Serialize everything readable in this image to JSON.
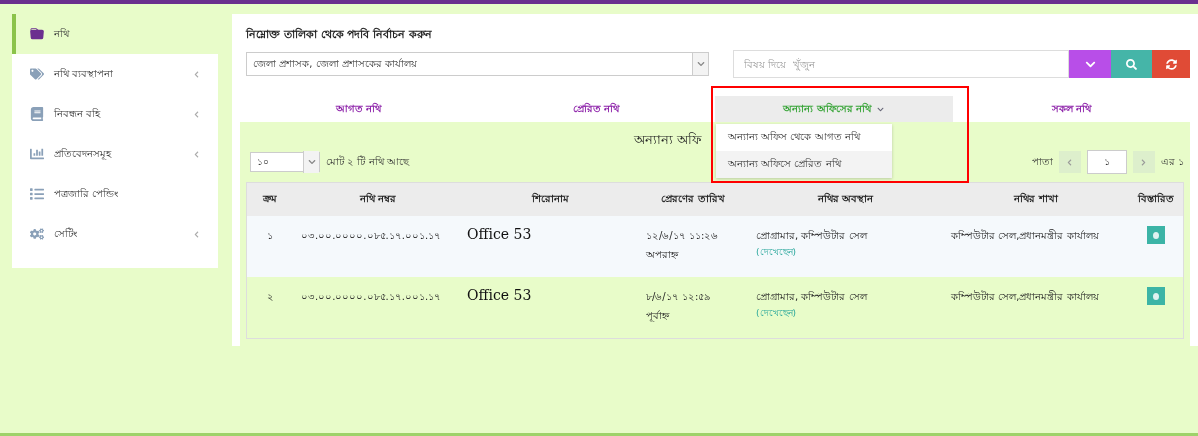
{
  "sidebar": {
    "items": [
      {
        "label": "নথি",
        "selected": true,
        "has_submenu": false
      },
      {
        "label": "নথি ব্যবস্থাপনা",
        "selected": false,
        "has_submenu": true
      },
      {
        "label": "নিবন্ধন বহি",
        "selected": false,
        "has_submenu": true
      },
      {
        "label": "প্রতিবেদনসমূহ",
        "selected": false,
        "has_submenu": true
      },
      {
        "label": "পত্রজারি পেন্ডিং",
        "selected": false,
        "has_submenu": false
      },
      {
        "label": "সেটিং",
        "selected": false,
        "has_submenu": true
      }
    ]
  },
  "position_picker": {
    "label": "নিম্নোক্ত তালিকা থেকে পদবি নির্বাচন করুন",
    "value": "জেলা প্রশাসক, জেলা প্রশাসকের কার্যালয়"
  },
  "search": {
    "placeholder": "বিষয় দিয়ে  খুঁজুন"
  },
  "tabs": [
    {
      "label": "আগত নথি",
      "selected": false,
      "has_menu": false
    },
    {
      "label": "প্রেরিত নথি",
      "selected": false,
      "has_menu": false
    },
    {
      "label": "অন্যান্য অফিসের নথি",
      "selected": true,
      "has_menu": true
    },
    {
      "label": "সকল নথি",
      "selected": false,
      "has_menu": false
    }
  ],
  "tab_menu": {
    "items": [
      {
        "label": "অন্যান্য অফিস থেকে আগত নথি",
        "selected": false
      },
      {
        "label": "অন্যান্য অফিসে প্রেরিত নথি",
        "selected": true
      }
    ]
  },
  "list": {
    "heading": "অন্যান্য অফি",
    "page_size": "১০",
    "total": "মোট ২ টি নথি আছে",
    "page_label": "পাতা",
    "page": "১",
    "page_of": "এর ১",
    "columns": [
      "ক্রম",
      "নথি নম্বর",
      "শিরোনাম",
      "প্রেরণের তারিখ",
      "নথির অবস্থান",
      "নথির শাখা",
      "বিস্তারিত"
    ],
    "rows": [
      {
        "serial": "১",
        "number": "০৩.০০.০০০০.০৮৫.১৭.০০১.১৭",
        "title": "Office 53",
        "date": "১২/৬/১৭ ১১:২৬",
        "period": "অপরাহ্ন",
        "location": "প্রোগ্রামার, কম্পিউটার সেল",
        "seen": "(দেখেছেন)",
        "branch": "কম্পিউটার সেল,প্রধানমন্ত্রীর কার্যালয়"
      },
      {
        "serial": "২",
        "number": "০৩.০০.০০০০.০৮৫.১৭.০০১.১৭",
        "title": "Office 53",
        "date": "৮/৬/১৭ ১২:৫৯",
        "period": "পূর্বাহ্ন",
        "location": "প্রোগ্রামার, কম্পিউটার সেল",
        "seen": "(দেখেছেন)",
        "branch": "কম্পিউটার সেল,প্রধানমন্ত্রীর কার্যালয়"
      }
    ]
  }
}
